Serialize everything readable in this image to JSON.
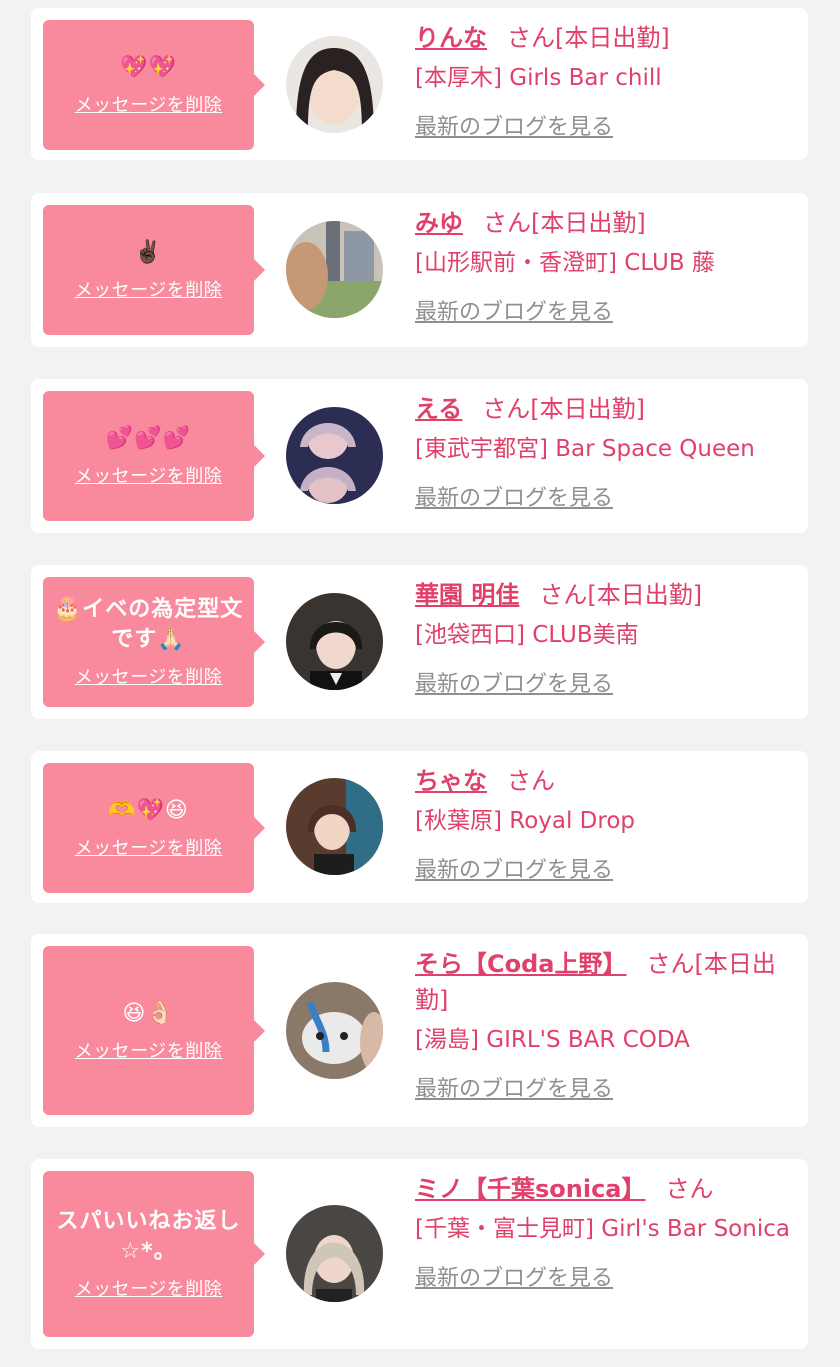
{
  "entries": [
    {
      "message": "💖💖",
      "delete_label": "メッセージを削除",
      "name": "りんな",
      "suffix": "さん[本日出勤]",
      "shop": "[本厚木] Girls Bar chill",
      "blog_label": "最新のブログを見る"
    },
    {
      "message": "✌🏿",
      "delete_label": "メッセージを削除",
      "name": "みゆ",
      "suffix": "さん[本日出勤]",
      "shop": "[山形駅前・香澄町] CLUB 藤",
      "blog_label": "最新のブログを見る"
    },
    {
      "message": "💕💕💕",
      "delete_label": "メッセージを削除",
      "name": "える",
      "suffix": "さん[本日出勤]",
      "shop": "[東武宇都宮] Bar Space Queen",
      "blog_label": "最新のブログを見る"
    },
    {
      "message": "🎂イベの為定型文です🙏🏻",
      "delete_label": "メッセージを削除",
      "name": "華園 明佳",
      "suffix": "さん[本日出勤]",
      "shop": "[池袋西口] CLUB美南",
      "blog_label": "最新のブログを見る"
    },
    {
      "message": "🫶💖😆",
      "delete_label": "メッセージを削除",
      "name": "ちゃな",
      "suffix": "さん",
      "shop": "[秋葉原] Royal Drop",
      "blog_label": "最新のブログを見る"
    },
    {
      "message": "😆👌🏻",
      "delete_label": "メッセージを削除",
      "name": "そら【Coda上野】",
      "suffix": "さん[本日出勤]",
      "shop": "[湯島] GIRL'S BAR CODA",
      "blog_label": "最新のブログを見る"
    },
    {
      "message": "スパいいねお返し☆*。",
      "delete_label": "メッセージを削除",
      "name": "ミノ【千葉sonica】",
      "suffix": "さん",
      "shop": "[千葉・富士見町] Girl's Bar Sonica",
      "blog_label": "最新のブログを見る"
    }
  ],
  "colors": {
    "accent": "#e0416a",
    "bubble": "#f98a9d",
    "muted_link": "#8f8f8f",
    "background": "#f2f2f2"
  }
}
